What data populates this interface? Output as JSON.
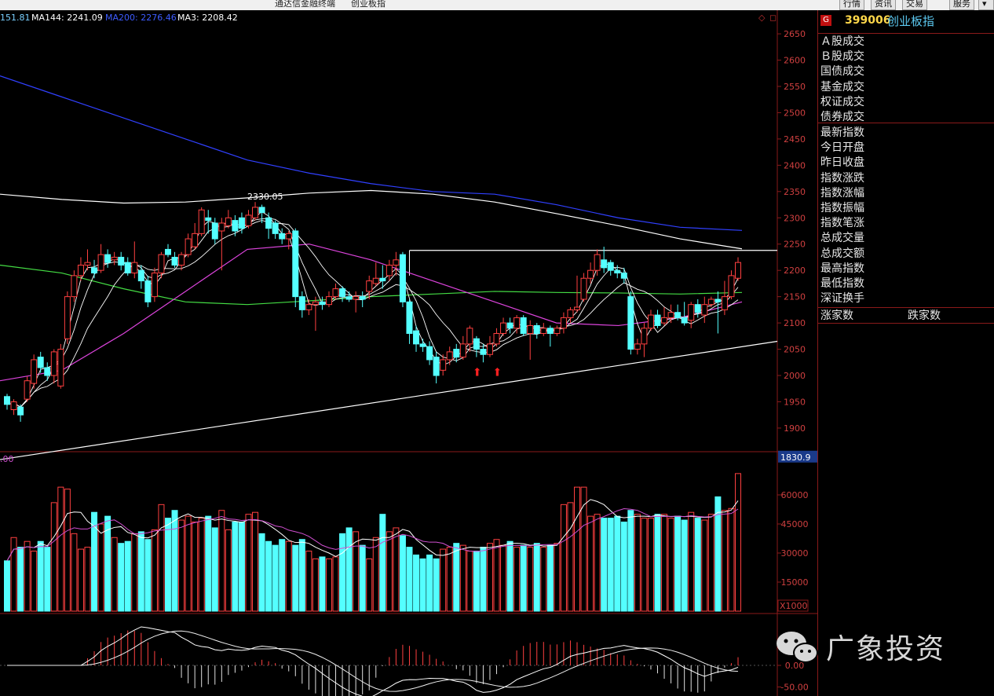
{
  "window": {
    "title_left": "通达信金融终端",
    "title_right": "创业板指",
    "buttons": [
      "行情",
      "资讯",
      "交易",
      "服务"
    ]
  },
  "legend": {
    "items": [
      {
        "text": "151.81",
        "color": "#7ad0ff"
      },
      {
        "text": "MA144: 2241.09",
        "color": "#ffffff"
      },
      {
        "text": "MA200: 2276.46",
        "color": "#3d5cff"
      },
      {
        "text": "MA3: 2208.42",
        "color": "#ffffff"
      }
    ]
  },
  "info_panel": {
    "badge": "G",
    "code": "399006",
    "name": "创业板指",
    "group1": [
      "Ａ股成交",
      "Ｂ股成交",
      "国债成交",
      "基金成交",
      "权证成交",
      "债券成交"
    ],
    "group2": [
      "最新指数",
      "今日开盘",
      "昨日收盘",
      "指数涨跌",
      "指数涨幅",
      "指数振幅",
      "指数笔涨",
      "总成交量",
      "总成交额",
      "最高指数",
      "最低指数",
      "深证换手"
    ],
    "advance_label": "涨家数",
    "decline_label": "跌家数"
  },
  "watermark": {
    "text": "广象投资",
    "icon": "wechat-icon"
  },
  "chart_data": [
    {
      "type": "candlestick",
      "panel": "price",
      "y_ticks": [
        1900,
        1950,
        2000,
        2050,
        2100,
        2150,
        2200,
        2250,
        2300,
        2350,
        2400,
        2450,
        2500,
        2550,
        2600,
        2650
      ],
      "ylim": [
        1870,
        2680
      ],
      "low_marker": "1830.9",
      "high_annotation": "2330.05",
      "candles": [
        [
          1960,
          1945,
          1965,
          1935
        ],
        [
          1935,
          1950,
          1955,
          1925
        ],
        [
          1940,
          1925,
          1945,
          1912
        ],
        [
          1955,
          1990,
          1998,
          1950
        ],
        [
          1985,
          2030,
          2040,
          1975
        ],
        [
          2035,
          2015,
          2045,
          2005
        ],
        [
          2015,
          2000,
          2025,
          1990
        ],
        [
          2000,
          2045,
          2050,
          1985
        ],
        [
          1980,
          2050,
          2060,
          1975
        ],
        [
          2070,
          2150,
          2160,
          2060
        ],
        [
          2150,
          2190,
          2200,
          2140
        ],
        [
          2190,
          2210,
          2225,
          2180
        ],
        [
          2210,
          2215,
          2240,
          2200
        ],
        [
          2205,
          2195,
          2220,
          2185
        ],
        [
          2200,
          2230,
          2250,
          2195
        ],
        [
          2230,
          2215,
          2240,
          2205
        ],
        [
          2220,
          2225,
          2235,
          2210
        ],
        [
          2225,
          2210,
          2235,
          2200
        ],
        [
          2215,
          2195,
          2225,
          2190
        ],
        [
          2195,
          2215,
          2255,
          2185
        ],
        [
          2200,
          2180,
          2210,
          2165
        ],
        [
          2180,
          2140,
          2190,
          2130
        ],
        [
          2150,
          2195,
          2205,
          2140
        ],
        [
          2195,
          2230,
          2235,
          2185
        ],
        [
          2240,
          2230,
          2250,
          2225
        ],
        [
          2225,
          2210,
          2235,
          2205
        ],
        [
          2210,
          2230,
          2235,
          2200
        ],
        [
          2230,
          2260,
          2270,
          2225
        ],
        [
          2245,
          2270,
          2290,
          2240
        ],
        [
          2270,
          2315,
          2320,
          2265
        ],
        [
          2300,
          2295,
          2315,
          2270
        ],
        [
          2290,
          2260,
          2300,
          2250
        ],
        [
          2275,
          2290,
          2300,
          2200
        ],
        [
          2285,
          2300,
          2315,
          2280
        ],
        [
          2295,
          2275,
          2305,
          2265
        ],
        [
          2300,
          2280,
          2310,
          2270
        ],
        [
          2285,
          2305,
          2315,
          2280
        ],
        [
          2300,
          2320,
          2330,
          2295
        ],
        [
          2320,
          2310,
          2325,
          2290
        ],
        [
          2300,
          2280,
          2310,
          2260
        ],
        [
          2290,
          2270,
          2295,
          2260
        ],
        [
          2270,
          2260,
          2280,
          2250
        ],
        [
          2260,
          2270,
          2275,
          2240
        ],
        [
          2275,
          2150,
          2280,
          2130
        ],
        [
          2150,
          2125,
          2160,
          2110
        ],
        [
          2125,
          2135,
          2145,
          2115
        ],
        [
          2135,
          2140,
          2150,
          2085
        ],
        [
          2140,
          2135,
          2150,
          2125
        ],
        [
          2135,
          2150,
          2160,
          2130
        ],
        [
          2150,
          2165,
          2175,
          2145
        ],
        [
          2165,
          2150,
          2170,
          2140
        ],
        [
          2150,
          2145,
          2160,
          2140
        ],
        [
          2145,
          2150,
          2160,
          2120
        ],
        [
          2150,
          2145,
          2160,
          2130
        ],
        [
          2160,
          2180,
          2190,
          2145
        ],
        [
          2175,
          2185,
          2215,
          2170
        ],
        [
          2185,
          2180,
          2210,
          2165
        ],
        [
          2190,
          2210,
          2220,
          2180
        ],
        [
          2210,
          2220,
          2235,
          2190
        ],
        [
          2230,
          2140,
          2235,
          2130
        ],
        [
          2140,
          2080,
          2145,
          2060
        ],
        [
          2085,
          2060,
          2095,
          2045
        ],
        [
          2060,
          2055,
          2070,
          2045
        ],
        [
          2055,
          2030,
          2065,
          2020
        ],
        [
          2035,
          2000,
          2045,
          1985
        ],
        [
          2010,
          2030,
          2040,
          2000
        ],
        [
          2030,
          2045,
          2055,
          2020
        ],
        [
          2050,
          2035,
          2060,
          2025
        ],
        [
          2035,
          2060,
          2075,
          2030
        ],
        [
          2060,
          2090,
          2095,
          2045
        ],
        [
          2070,
          2050,
          2075,
          2035
        ],
        [
          2050,
          2040,
          2060,
          2025
        ],
        [
          2040,
          2060,
          2075,
          2035
        ],
        [
          2060,
          2080,
          2090,
          2055
        ],
        [
          2080,
          2100,
          2110,
          2075
        ],
        [
          2100,
          2090,
          2110,
          2080
        ],
        [
          2090,
          2110,
          2115,
          2080
        ],
        [
          2110,
          2080,
          2115,
          2075
        ],
        [
          2080,
          2095,
          2105,
          2030
        ],
        [
          2095,
          2080,
          2100,
          2070
        ],
        [
          2080,
          2090,
          2100,
          2075
        ],
        [
          2090,
          2080,
          2095,
          2055
        ],
        [
          2080,
          2090,
          2095,
          2075
        ],
        [
          2090,
          2110,
          2120,
          2080
        ],
        [
          2110,
          2125,
          2130,
          2100
        ],
        [
          2125,
          2130,
          2190,
          2120
        ],
        [
          2145,
          2185,
          2195,
          2140
        ],
        [
          2185,
          2200,
          2215,
          2175
        ],
        [
          2200,
          2230,
          2240,
          2190
        ],
        [
          2220,
          2205,
          2245,
          2195
        ],
        [
          2215,
          2200,
          2220,
          2190
        ],
        [
          2200,
          2195,
          2210,
          2185
        ],
        [
          2195,
          2185,
          2205,
          2175
        ],
        [
          2150,
          2050,
          2160,
          2040
        ],
        [
          2050,
          2060,
          2070,
          2040
        ],
        [
          2060,
          2090,
          2100,
          2035
        ],
        [
          2090,
          2115,
          2125,
          2085
        ],
        [
          2115,
          2095,
          2125,
          2090
        ],
        [
          2100,
          2110,
          2130,
          2095
        ],
        [
          2110,
          2120,
          2135,
          2100
        ],
        [
          2120,
          2110,
          2135,
          2105
        ],
        [
          2110,
          2100,
          2140,
          2095
        ],
        [
          2105,
          2135,
          2140,
          2090
        ],
        [
          2135,
          2120,
          2145,
          2110
        ],
        [
          2115,
          2135,
          2150,
          2100
        ],
        [
          2135,
          2145,
          2150,
          2130
        ],
        [
          2145,
          2140,
          2160,
          2080
        ],
        [
          2125,
          2150,
          2180,
          2115
        ],
        [
          2150,
          2190,
          2200,
          2145
        ],
        [
          2185,
          2215,
          2225,
          2180
        ]
      ],
      "lines": [
        {
          "name": "MA200",
          "color": "#3040ff",
          "values": [
            2570,
            2530,
            2490,
            2450,
            2410,
            2385,
            2365,
            2350,
            2345,
            2325,
            2300,
            2282,
            2276
          ]
        },
        {
          "name": "MA144",
          "color": "#ffffff",
          "values": [
            2345,
            2335,
            2328,
            2330,
            2338,
            2347,
            2352,
            2345,
            2330,
            2308,
            2285,
            2260,
            2241
          ]
        },
        {
          "name": "MA60",
          "color": "#44dd44",
          "values": [
            2210,
            2195,
            2165,
            2140,
            2135,
            2142,
            2150,
            2155,
            2160,
            2158,
            2157,
            2155,
            2158
          ]
        },
        {
          "name": "MA30",
          "color": "#dd44dd",
          "values": [
            1990,
            2010,
            2080,
            2160,
            2240,
            2250,
            2220,
            2180,
            2140,
            2100,
            2095,
            2110,
            2140
          ]
        }
      ],
      "trendlines": [
        {
          "name": "support",
          "from": [
            0,
            1840
          ],
          "to": [
            110,
            2065
          ]
        },
        {
          "name": "resistance",
          "from": [
            60,
            2238
          ],
          "to": [
            110,
            2238
          ]
        }
      ]
    },
    {
      "type": "bar",
      "panel": "volume",
      "unit": "X1000",
      "y_ticks": [
        15000,
        30000,
        45000,
        60000
      ],
      "ylim": [
        0,
        75000
      ],
      "values": [
        26000,
        38000,
        33000,
        36000,
        31000,
        36000,
        33000,
        56000,
        64000,
        63000,
        40000,
        32000,
        33000,
        51000,
        45000,
        49000,
        38000,
        35000,
        36000,
        40000,
        41000,
        37000,
        42000,
        55000,
        48000,
        52000,
        47000,
        49000,
        46000,
        48000,
        49000,
        43000,
        52000,
        42000,
        46000,
        46000,
        50000,
        51000,
        40000,
        36000,
        34000,
        37000,
        36000,
        34000,
        37000,
        31000,
        27000,
        28000,
        27000,
        28000,
        40000,
        43000,
        41000,
        34000,
        27000,
        38000,
        50000,
        41000,
        43000,
        39000,
        33000,
        29000,
        27000,
        29000,
        27000,
        32000,
        33000,
        35000,
        34000,
        31000,
        31000,
        33000,
        35000,
        37000,
        34000,
        36000,
        33000,
        34000,
        33000,
        35000,
        33000,
        34000,
        35000,
        55000,
        56000,
        64000,
        64000,
        49000,
        50000,
        48000,
        48000,
        49000,
        46000,
        52000,
        50000,
        48000,
        48000,
        50000,
        50000,
        48000,
        49000,
        47000,
        51000,
        48000,
        47000,
        50000,
        59000,
        52000,
        53000,
        71000
      ]
    },
    {
      "type": "bar",
      "panel": "macd",
      "y_ticks": [
        0.0,
        -50.0
      ],
      "tick_labels": [
        "0.00",
        "-50.00"
      ],
      "ylim": [
        -80,
        80
      ]
    }
  ]
}
